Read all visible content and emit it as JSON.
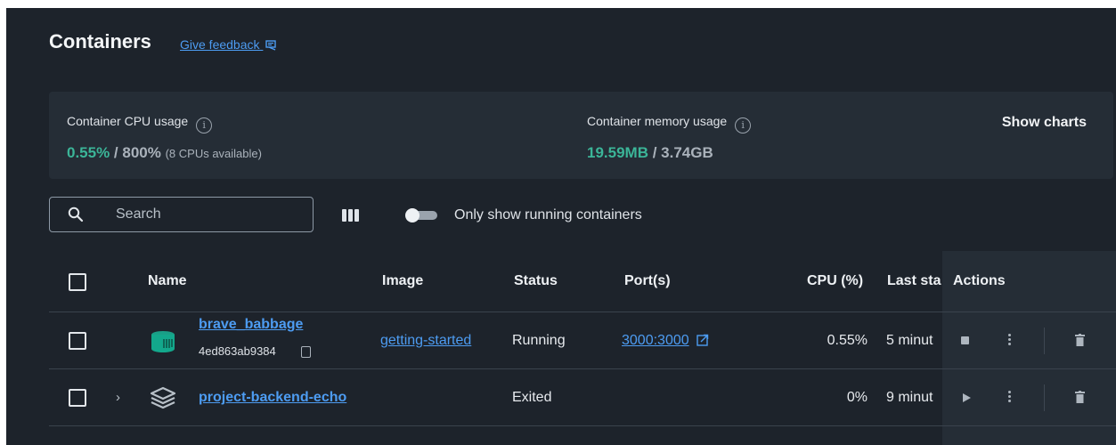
{
  "header": {
    "title": "Containers",
    "feedback_label": "Give feedback"
  },
  "stats": {
    "cpu": {
      "label": "Container CPU usage",
      "used": "0.55%",
      "separator": " / ",
      "total": "800%",
      "note": "(8 CPUs available)"
    },
    "memory": {
      "label": "Container memory usage",
      "used": "19.59MB",
      "separator": " / ",
      "total": "3.74GB"
    },
    "show_charts_label": "Show charts"
  },
  "toolbar": {
    "search_placeholder": "Search",
    "toggle_label": "Only show running containers",
    "toggle_on": false
  },
  "table": {
    "columns": {
      "name": "Name",
      "image": "Image",
      "status": "Status",
      "ports": "Port(s)",
      "cpu": "CPU (%)",
      "last_started": "Last sta",
      "actions": "Actions"
    },
    "rows": [
      {
        "name": "brave_babbage",
        "id": "4ed863ab9384",
        "image": "getting-started",
        "status": "Running",
        "ports": "3000:3000",
        "cpu": "0.55%",
        "last_started": "5 minut",
        "icon": "container-icon",
        "primary_action": "stop-icon"
      },
      {
        "name": "project-backend-echo",
        "id": "",
        "image": "",
        "status": "Exited",
        "ports": "",
        "cpu": "0%",
        "last_started": "9 minut",
        "icon": "stack-icon",
        "primary_action": "play-icon"
      }
    ]
  },
  "colors": {
    "background": "#1d232b",
    "card": "#252d36",
    "accent_link": "#4d9cf2",
    "usage_green": "#3bb598"
  }
}
